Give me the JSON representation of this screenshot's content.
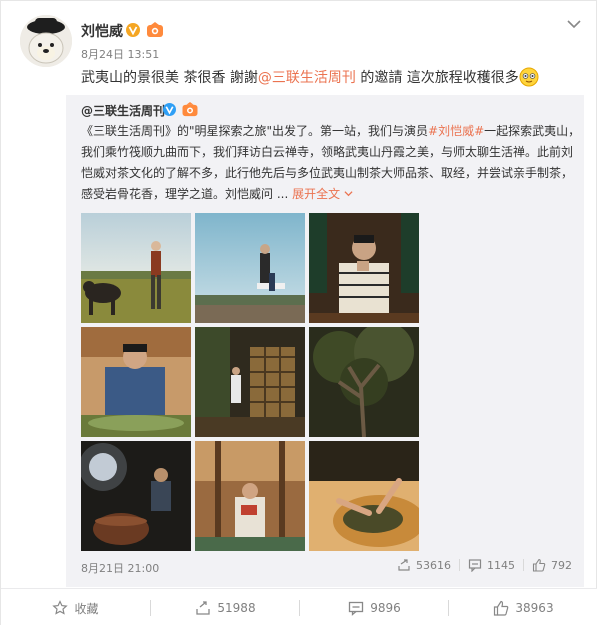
{
  "post": {
    "author": "刘恺威",
    "time": "8月24日 13:51",
    "text_a": "武夷山的景很美 茶很香 謝謝",
    "mention": "@三联生活周刊",
    "text_b": " 的邀請 這次旅程收穫很多"
  },
  "repost": {
    "author": "@三联生活周刊",
    "line1_a": "《三联生活周刊》的\"明星探索之旅\"出发了。第一站，我们与演员",
    "line1_tag": "#刘恺威#",
    "line1_b": "一起探索武夷山，",
    "line2": "我们乘竹筏顺九曲而下，我们拜访白云禅寺，领略武夷山丹霞之美，与师太聊生活禅。此前刘",
    "line3": "恺威对茶文化的了解不多，此行他先后与多位武夷山制茶大师品茶、取经，并尝试亲手制茶，",
    "line4": "感受岩骨花香，理学之道。刘恺威问 ...",
    "expand_label": "展开全文",
    "time": "8月21日 21:00",
    "reposts": "53616",
    "comments": "1145",
    "likes": "792",
    "photos": [
      "photo-buffalo-field",
      "photo-bamboo-raft-sky",
      "photo-tea-tasting-window",
      "photo-tea-roasting-bamboo",
      "photo-courtyard-window",
      "photo-big-tree",
      "photo-dark-workshop",
      "photo-reading-balcony",
      "photo-tea-hands"
    ]
  },
  "actions": {
    "favorite_label": "收藏",
    "repost_count": "51988",
    "comment_count": "9896",
    "like_count": "38963"
  },
  "icons": {
    "verified": "verified-v-icon",
    "level": "level-badge-icon",
    "more": "chevron-down-icon",
    "emoji": "smile-emoji-icon",
    "expand": "chevron-down-icon",
    "repost": "repost-icon",
    "comment": "comment-icon",
    "like": "thumb-up-icon",
    "favorite": "star-icon"
  },
  "colors": {
    "accent": "#eb7350",
    "text": "#333333",
    "muted": "#808080",
    "repost_bg": "#f2f2f5",
    "verified": "#f5a623"
  }
}
